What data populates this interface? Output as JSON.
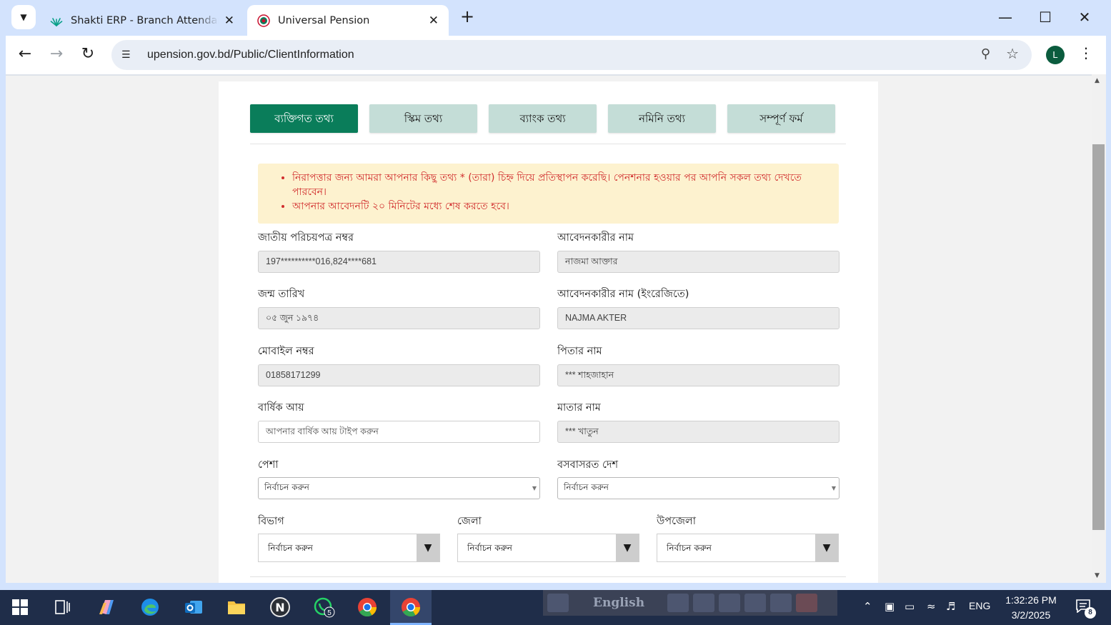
{
  "browser": {
    "tabs": [
      {
        "title": "Shakti ERP - Branch Attendance",
        "active": false
      },
      {
        "title": "Universal Pension",
        "active": true
      }
    ],
    "url": "upension.gov.bd/Public/ClientInformation",
    "profile_initial": "L"
  },
  "steps": [
    {
      "label": "ব্যক্তিগত তথ্য",
      "active": true
    },
    {
      "label": "স্কিম তথ্য",
      "active": false
    },
    {
      "label": "ব্যাংক তথ্য",
      "active": false
    },
    {
      "label": "নমিনি তথ্য",
      "active": false
    },
    {
      "label": "সম্পূর্ণ ফর্ম",
      "active": false
    }
  ],
  "notice": [
    "নিরাপত্তার জন্য আমরা আপনার কিছু তথ্য * (তারা) চিহ্ন দিয়ে প্রতিস্থাপন করেছি। পেনশনার হওয়ার পর আপনি সকল তথ্য দেখতে পারবেন।",
    "আপনার আবেদনটি ২০ মিনিটের মধ্যে শেষ করতে হবে।"
  ],
  "form": {
    "nid": {
      "label": "জাতীয় পরিচয়পত্র নম্বর",
      "value": "197**********016,824****681"
    },
    "applicant_name": {
      "label": "আবেদনকারীর নাম",
      "value": "নাজমা আক্তার"
    },
    "dob": {
      "label": "জন্ম তারিখ",
      "value": "০৫ জুন ১৯৭৪"
    },
    "applicant_name_en": {
      "label": "আবেদনকারীর নাম (ইংরেজিতে)",
      "value": "NAJMA AKTER"
    },
    "mobile": {
      "label": "মোবাইল নম্বর",
      "value": "01858171299"
    },
    "father": {
      "label": "পিতার নাম",
      "value": "*** শাহজাহান"
    },
    "income": {
      "label": "বার্ষিক আয়",
      "placeholder": "আপনার বার্ষিক আয় টাইপ করুন"
    },
    "mother": {
      "label": "মাতার নাম",
      "value": "*** খাতুন"
    },
    "occupation": {
      "label": "পেশা",
      "value": "নির্বাচন করুন"
    },
    "country": {
      "label": "বসবাসরত দেশ",
      "value": "নির্বাচন করুন"
    },
    "division": {
      "label": "বিভাগ",
      "value": "নির্বাচন করুন"
    },
    "district": {
      "label": "জেলা",
      "value": "নির্বাচন করুন"
    },
    "upazila": {
      "label": "উপজেলা",
      "value": "নির্বাচন করুন"
    }
  },
  "taskbar": {
    "whatsapp_badge": "5",
    "language_bar": "English",
    "tray_lang": "ENG",
    "time": "1:32:26 PM",
    "date": "3/2/2025",
    "notification_count": "8"
  },
  "colors": {
    "primary_green": "#0a7d5a",
    "step_inactive": "#c4ddd7",
    "notice_bg": "#fdf2cf",
    "notice_text": "#d12d2d"
  }
}
